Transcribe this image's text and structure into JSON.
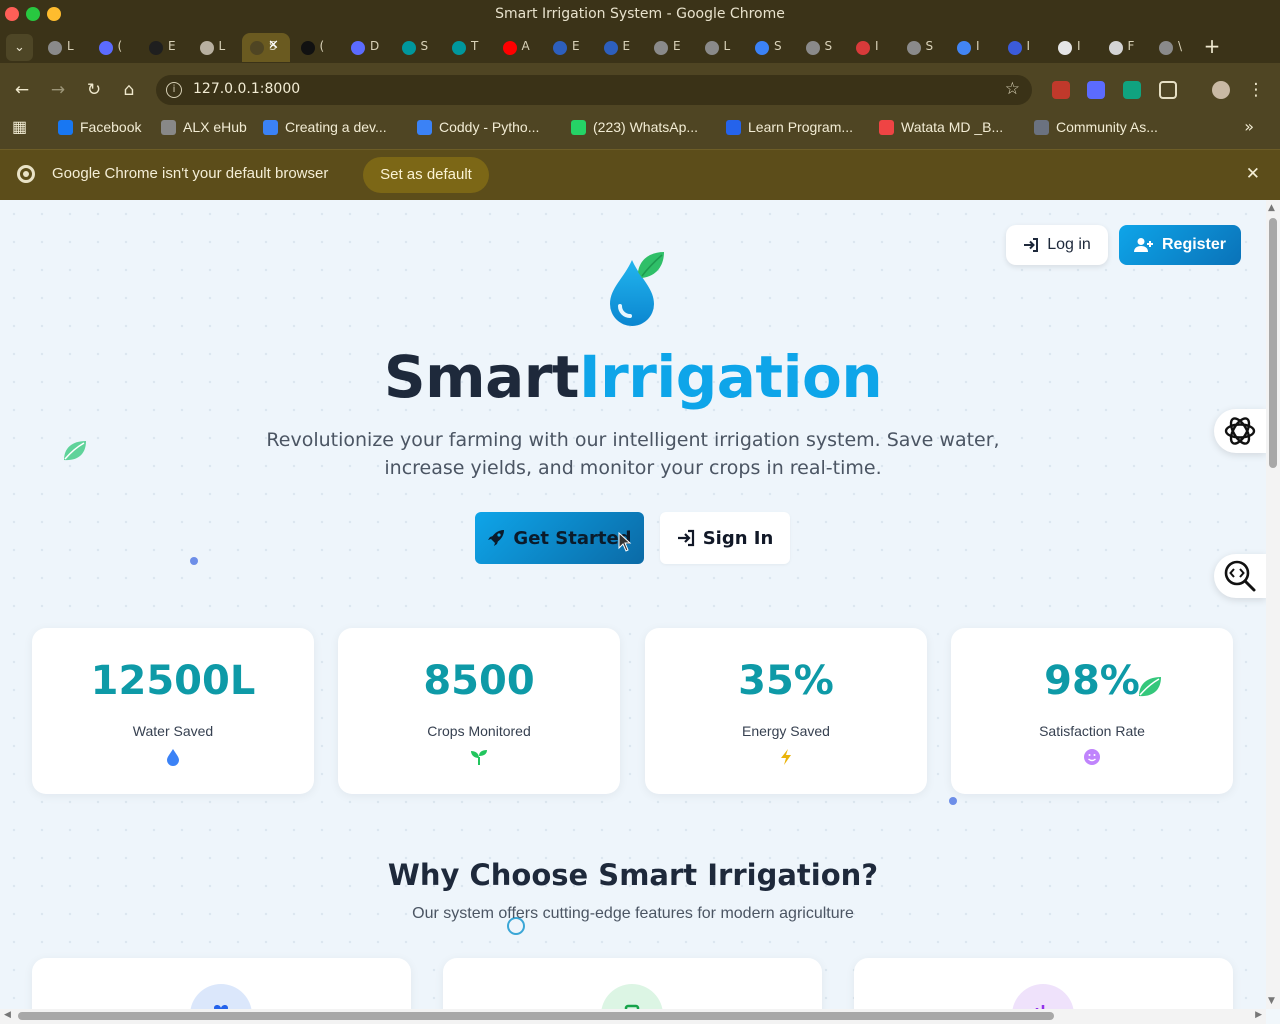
{
  "window": {
    "title": "Smart Irrigation System - Google Chrome"
  },
  "tabs": [
    {
      "label": "L",
      "color": "#8a8a8a"
    },
    {
      "label": "(",
      "color": "#5b6bff"
    },
    {
      "label": "E",
      "color": "#1f1f1f"
    },
    {
      "label": "L",
      "color": "#b8b0a0"
    },
    {
      "label": "S",
      "color": "#4f4523",
      "active": true
    },
    {
      "label": "(",
      "color": "#111111"
    },
    {
      "label": "D",
      "color": "#5b6bff"
    },
    {
      "label": "S",
      "color": "#00979d"
    },
    {
      "label": "T",
      "color": "#00979d"
    },
    {
      "label": "A",
      "color": "#ff0000"
    },
    {
      "label": "E",
      "color": "#2d5fbd"
    },
    {
      "label": "E",
      "color": "#2d5fbd"
    },
    {
      "label": "E",
      "color": "#8a8a8a"
    },
    {
      "label": "L",
      "color": "#8a8a8a"
    },
    {
      "label": "S",
      "color": "#3b82f6"
    },
    {
      "label": "S",
      "color": "#8a8a8a"
    },
    {
      "label": "I",
      "color": "#d83a3a"
    },
    {
      "label": "S",
      "color": "#8a8a8a"
    },
    {
      "label": "I",
      "color": "#4285f4"
    },
    {
      "label": "I",
      "color": "#3b5bdb"
    },
    {
      "label": "I",
      "color": "#e5e5e5"
    },
    {
      "label": "F",
      "color": "#d4d4d4"
    },
    {
      "label": "\\",
      "color": "#8a8a8a"
    }
  ],
  "toolbar": {
    "url": "127.0.0.1:8000"
  },
  "bookmarks": [
    {
      "label": "Facebook",
      "icon_color": "#1877f2"
    },
    {
      "label": "ALX eHub",
      "icon_color": "#888888"
    },
    {
      "label": "Creating a dev...",
      "icon_color": "#3b82f6"
    },
    {
      "label": "Coddy - Pytho...",
      "icon_color": "#3b82f6"
    },
    {
      "label": "(223) WhatsAp...",
      "icon_color": "#25d366"
    },
    {
      "label": "Learn Program...",
      "icon_color": "#2563eb"
    },
    {
      "label": "Watata MD _B...",
      "icon_color": "#ef4444"
    },
    {
      "label": "Community As...",
      "icon_color": "#6b7280"
    }
  ],
  "infobar": {
    "text": "Google Chrome isn't your default browser",
    "button": "Set as default"
  },
  "header": {
    "login": "Log in",
    "register": "Register"
  },
  "hero": {
    "title_part1": "Smart",
    "title_part2": "Irrigation",
    "subtitle": "Revolutionize your farming with our intelligent irrigation system. Save water, increase yields, and monitor your crops in real-time.",
    "primary_cta": "Get Started",
    "secondary_cta": "Sign In"
  },
  "stats": [
    {
      "value": "12500L",
      "label": "Water Saved",
      "icon": "water-drop-icon"
    },
    {
      "value": "8500",
      "label": "Crops Monitored",
      "icon": "seedling-icon"
    },
    {
      "value": "35%",
      "label": "Energy Saved",
      "icon": "lightning-icon"
    },
    {
      "value": "98%",
      "label": "Satisfaction Rate",
      "icon": "smile-icon"
    }
  ],
  "why": {
    "title": "Why Choose Smart Irrigation?",
    "subtitle": "Our system offers cutting-edge features for modern agriculture"
  },
  "colors": {
    "accent": "#0ea5e9",
    "stat_value": "#0e9aa7",
    "heading": "#1e293b"
  }
}
